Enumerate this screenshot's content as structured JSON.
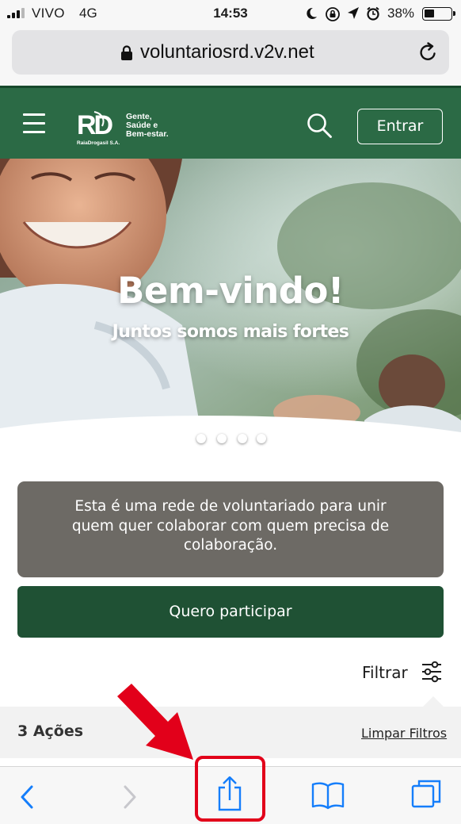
{
  "status_bar": {
    "carrier": "VIVO",
    "network": "4G",
    "time": "14:53",
    "battery_percent": "38%",
    "signal_bars": 3,
    "signal_max": 4,
    "battery_level": 0.38
  },
  "browser": {
    "url": "voluntariosrd.v2v.net"
  },
  "site_header": {
    "logo_text": "Gente, Saúde e Bem-estar",
    "logo_sub": "RaiaDrogasil S.A.",
    "login_label": "Entrar"
  },
  "hero": {
    "title": "Bem-vindo!",
    "subtitle": "Juntos somos mais fortes",
    "slide_count": 4
  },
  "intro": {
    "text": "Esta é uma rede de voluntariado para unir quem quer colaborar com quem precisa de colaboração."
  },
  "cta": {
    "label": "Quero participar"
  },
  "filter": {
    "label": "Filtrar"
  },
  "results": {
    "count_label": "3 Ações",
    "clear_label": "Limpar Filtros"
  },
  "colors": {
    "brand_green": "#2b6a45",
    "cta_green": "#1f5134",
    "intro_gray": "#6d6a65",
    "ios_blue": "#157efb",
    "annotation_red": "#e2001a"
  },
  "icons": {
    "menu": "hamburger-icon",
    "search": "search-icon",
    "filter": "sliders-icon",
    "back": "chevron-left-icon",
    "forward": "chevron-right-icon",
    "share": "share-icon",
    "bookmarks": "book-icon",
    "tabs": "tabs-icon"
  }
}
